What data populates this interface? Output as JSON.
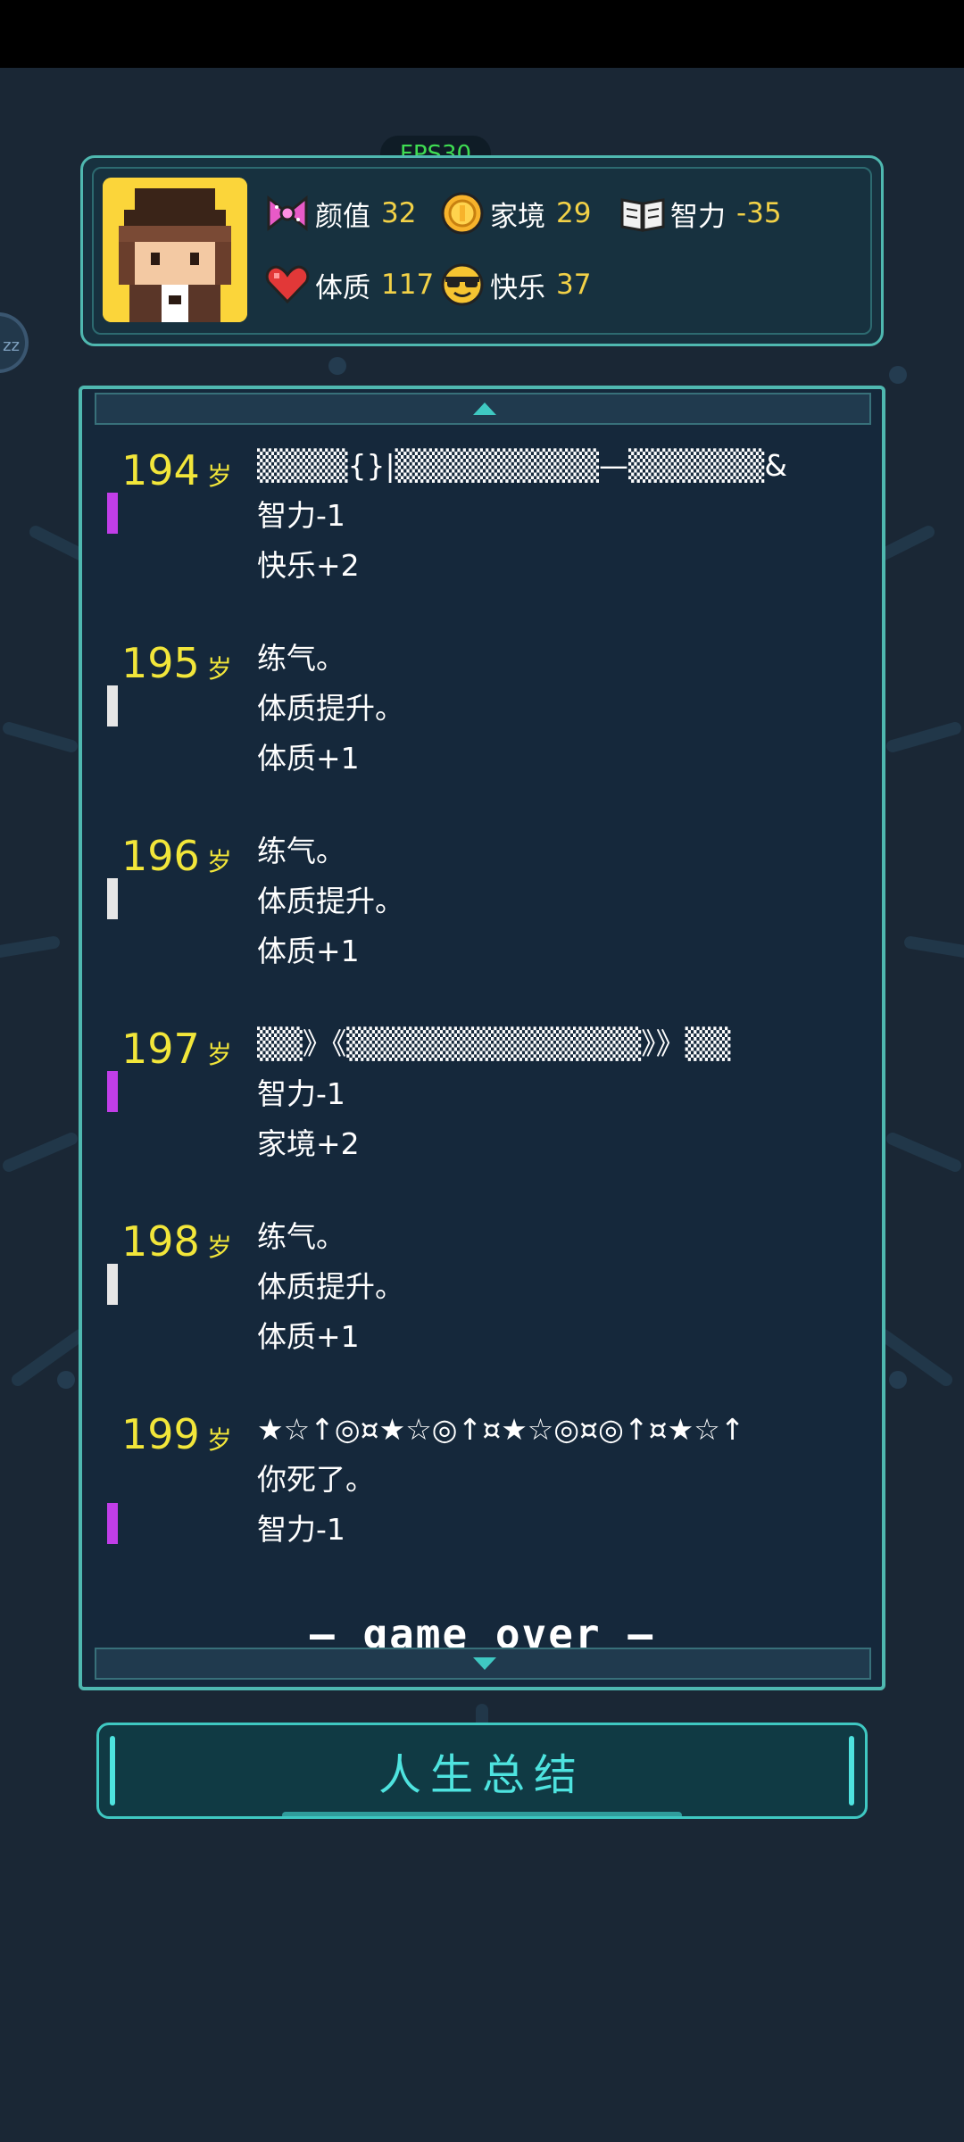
{
  "fps": "FPS30",
  "float_button": "zz",
  "stats": {
    "beauty": {
      "label": "颜值",
      "value": "32",
      "icon": "bow-icon"
    },
    "family": {
      "label": "家境",
      "value": "29",
      "icon": "coin-icon"
    },
    "intelligence": {
      "label": "智力",
      "value": "-35",
      "icon": "book-icon"
    },
    "constitution": {
      "label": "体质",
      "value": "117",
      "icon": "heart-icon"
    },
    "happiness": {
      "label": "快乐",
      "value": "37",
      "icon": "sunglasses-icon"
    }
  },
  "log": [
    {
      "age": "194",
      "unit": "岁",
      "marker": "#c13ee8",
      "lines": [
        "▒▒▒▒{}|▒▒▒▒▒▒▒▒▒—▒▒▒▒▒▒&",
        "智力-1",
        "快乐+2"
      ]
    },
    {
      "age": "195",
      "unit": "岁",
      "marker": "#e6e6e6",
      "lines": [
        "练气。",
        "体质提升。",
        "体质+1"
      ]
    },
    {
      "age": "196",
      "unit": "岁",
      "marker": "#e6e6e6",
      "lines": [
        "练气。",
        "体质提升。",
        "体质+1"
      ]
    },
    {
      "age": "197",
      "unit": "岁",
      "marker": "#c13ee8",
      "lines": [
        "▒▒》《▒▒▒▒▒▒▒▒▒▒▒▒▒》》▒▒",
        "智力-1",
        "家境+2"
      ]
    },
    {
      "age": "198",
      "unit": "岁",
      "marker": "#e6e6e6",
      "lines": [
        "练气。",
        "体质提升。",
        "体质+1"
      ]
    },
    {
      "age": "199",
      "unit": "岁",
      "marker": "#c13ee8",
      "lines": [
        "★☆↑◎¤★☆◎↑¤★☆◎¤◎↑¤★☆↑",
        "你死了。",
        "智力-1"
      ]
    }
  ],
  "game_over": "— game over —",
  "summary_button": "人生总结"
}
